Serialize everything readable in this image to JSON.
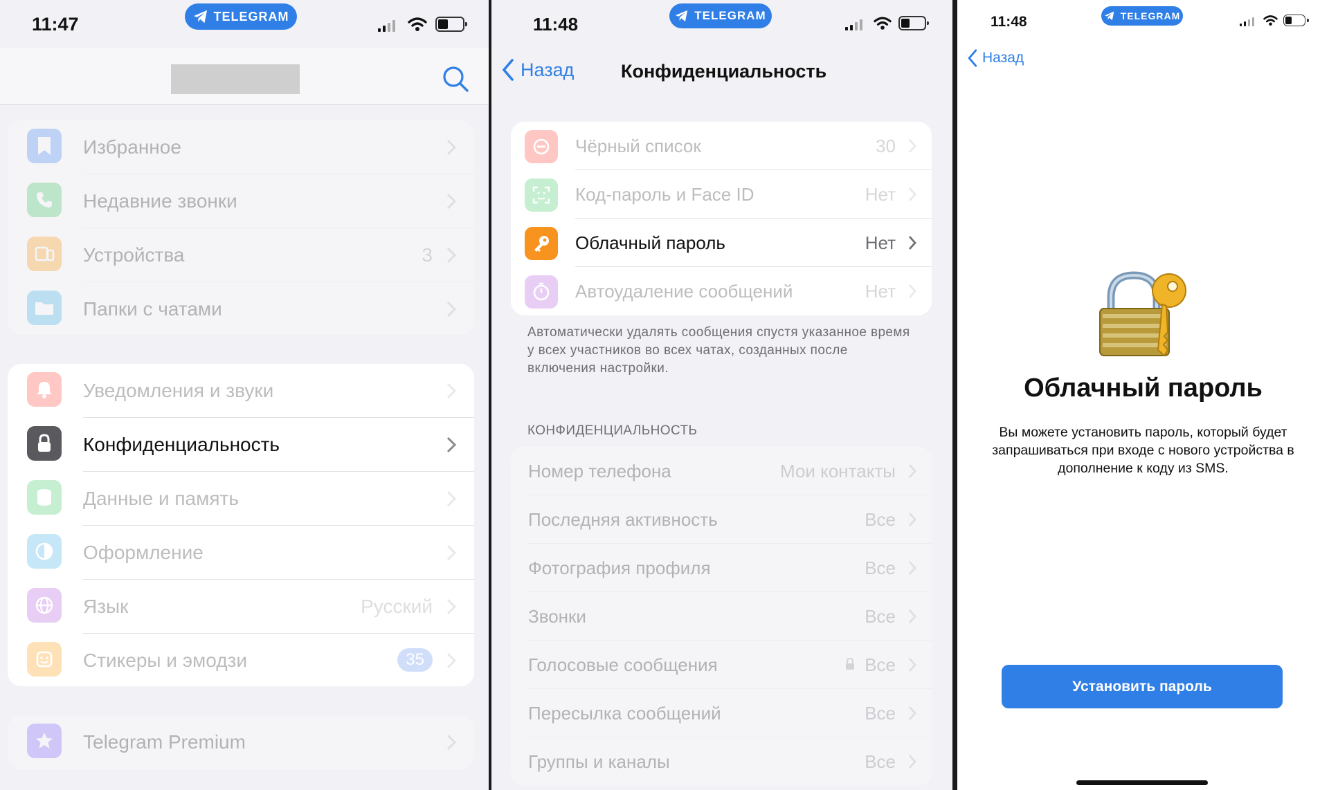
{
  "panel1": {
    "time": "11:47",
    "app_pill": "TELEGRAM",
    "groups": [
      {
        "rows": [
          {
            "label": "Избранное",
            "value": "",
            "icon": "bookmark-icon",
            "color": "#3b82f6"
          },
          {
            "label": "Недавние звонки",
            "value": "",
            "icon": "phone-icon",
            "color": "#34c759"
          },
          {
            "label": "Устройства",
            "value": "3",
            "icon": "devices-icon",
            "color": "#ff9500"
          },
          {
            "label": "Папки с чатами",
            "value": "",
            "icon": "folder-icon",
            "color": "#32ade6"
          }
        ]
      },
      {
        "rows": [
          {
            "label": "Уведомления и звуки",
            "value": "",
            "icon": "bell-icon",
            "color": "#ff3b30"
          },
          {
            "label": "Конфиденциальность",
            "value": "",
            "icon": "lock-icon",
            "color": "#5a5a5e"
          },
          {
            "label": "Данные и память",
            "value": "",
            "icon": "database-icon",
            "color": "#34c759"
          },
          {
            "label": "Оформление",
            "value": "",
            "icon": "appearance-icon",
            "color": "#32ade6"
          },
          {
            "label": "Язык",
            "value": "Русский",
            "icon": "globe-icon",
            "color": "#af52de"
          },
          {
            "label": "Стикеры и эмодзи",
            "value": "35",
            "icon": "sticker-icon",
            "color": "#ff9500"
          }
        ]
      },
      {
        "rows": [
          {
            "label": "Telegram Premium",
            "value": "",
            "icon": "star-icon",
            "color": "#7c5cff"
          }
        ]
      }
    ]
  },
  "panel2": {
    "time": "11:48",
    "app_pill": "TELEGRAM",
    "back_label": "Назад",
    "title": "Конфиденциальность",
    "security_rows": [
      {
        "label": "Чёрный список",
        "value": "30",
        "icon": "blocked-icon",
        "color": "#ff3b30"
      },
      {
        "label": "Код-пароль и Face ID",
        "value": "Нет",
        "icon": "faceid-icon",
        "color": "#34c759"
      },
      {
        "label": "Облачный пароль",
        "value": "Нет",
        "icon": "key-icon",
        "color": "#f7931e"
      },
      {
        "label": "Автоудаление сообщений",
        "value": "Нет",
        "icon": "timer-icon",
        "color": "#af52de"
      }
    ],
    "autodelete_note": "Автоматически удалять сообщения спустя указанное время у всех участников во всех чатах, созданных после включения настройки.",
    "privacy_header": "КОНФИДЕНЦИАЛЬНОСТЬ",
    "privacy_rows": [
      {
        "label": "Номер телефона",
        "value": "Мои контакты"
      },
      {
        "label": "Последняя активность",
        "value": "Все"
      },
      {
        "label": "Фотография профиля",
        "value": "Все"
      },
      {
        "label": "Звонки",
        "value": "Все"
      },
      {
        "label": "Голосовые сообщения",
        "value": "Все"
      },
      {
        "label": "Пересылка сообщений",
        "value": "Все"
      },
      {
        "label": "Группы и каналы",
        "value": "Все"
      }
    ]
  },
  "panel3": {
    "time": "11:48",
    "app_pill": "TELEGRAM",
    "back_label": "Назад",
    "title": "Облачный пароль",
    "description": "Вы можете установить пароль, который будет запрашиваться при входе с нового устройства в дополнение к коду из SMS.",
    "button_label": "Установить пароль"
  },
  "colors": {
    "accent": "#2f7fe6",
    "grouped_bg": "#f2f2f6",
    "key_icon": "#f7931e"
  }
}
